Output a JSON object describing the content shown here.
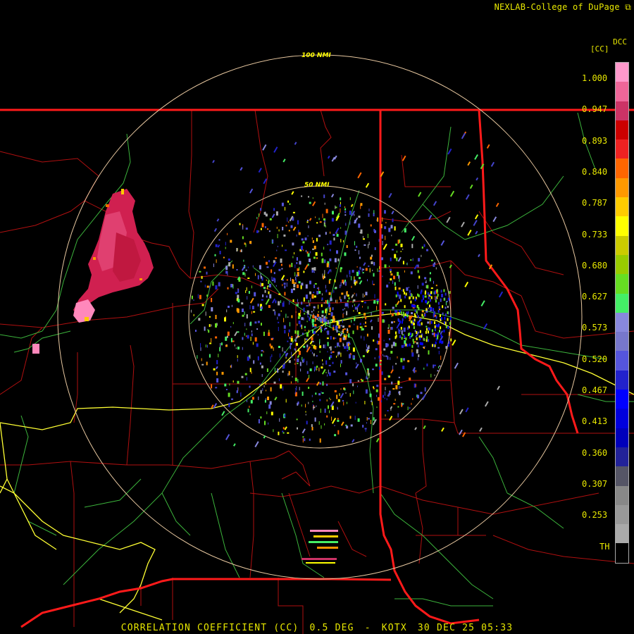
{
  "header": {
    "credit": "NEXLAB-College of DuPage",
    "credit_icon": "external-link-icon",
    "station_code": "DCC",
    "unit": "[CC]"
  },
  "rings": [
    {
      "label": "100 NMI"
    },
    {
      "label": "50 NMI"
    }
  ],
  "legend": {
    "ticks": [
      "1.000",
      "0.947",
      "0.893",
      "0.840",
      "0.787",
      "0.733",
      "0.680",
      "0.627",
      "0.573",
      "0.520",
      "0.467",
      "0.413",
      "0.360",
      "0.307",
      "0.253",
      "TH"
    ],
    "colors": {
      "top": [
        "#ff99cc",
        "#ee6699",
        "#cc3366",
        "#cc0000",
        "#ee2222",
        "#ff6600",
        "#ff9900",
        "#ffcc00",
        "#ffff00",
        "#cccc00",
        "#99cc00",
        "#66dd22",
        "#44ee66",
        "#8888dd",
        "#7777cc",
        "#5555dd",
        "#2222cc",
        "#0000ff",
        "#0000dd",
        "#0000bb",
        "#222299",
        "#555566",
        "#888888",
        "#999999",
        "#aaaaaa",
        "#000000"
      ]
    }
  },
  "footer": {
    "product": "CORRELATION COEFFICIENT (CC)",
    "elevation": "0.5 DEG",
    "separator": "-",
    "station": "KOTX",
    "timestamp": "30 DEC 25 05:33"
  },
  "palette": {
    "background": "#000000",
    "state_border": "#ff1a1a",
    "county_border": "#b01010",
    "highway": "#ffff33",
    "road": "#3cb43c",
    "range_ring": "#e8c8a0",
    "text": "#e8e800"
  }
}
